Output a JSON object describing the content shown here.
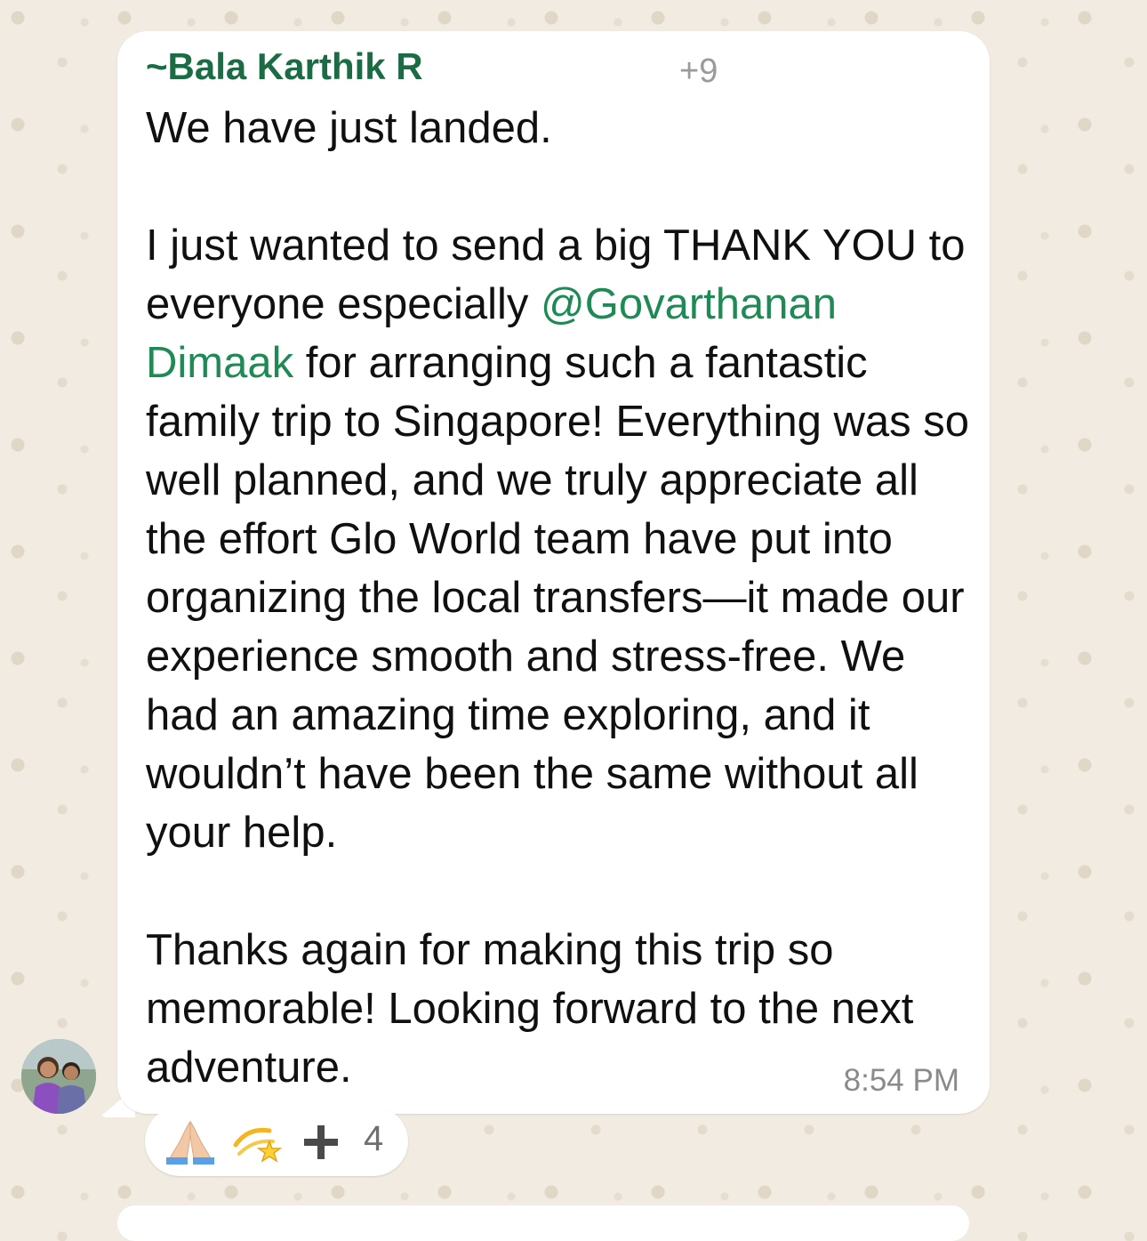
{
  "message": {
    "sender_prefix": "~",
    "sender_name": "Bala Karthik R",
    "phone_partial": "+9",
    "paragraph1": "We have just landed.",
    "paragraph2_before": "I just wanted to send a big THANK YOU to everyone especially ",
    "mention": "@Govarthanan Dimaak",
    "paragraph2_after": " for arranging such a fantastic family trip to Singapore! Everything was so well planned, and we truly appreciate all the effort Glo World team have put into organizing the local transfers—it made our experience smooth and stress-free. We had an amazing time exploring, and it wouldn’t have been the same without all your help.",
    "paragraph3": "Thanks again for making this trip so memorable! Looking forward to the next adventure.",
    "time": "8:54 PM"
  },
  "reactions": {
    "items": [
      "folded-hands-icon",
      "dizzy-star-icon"
    ],
    "count": "4"
  },
  "colors": {
    "mention": "#1f8a55",
    "sender": "#1b6b45",
    "background": "#f1ebe1"
  }
}
